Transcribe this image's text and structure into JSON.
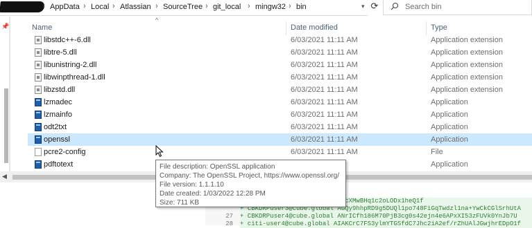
{
  "address_bar": {
    "path": [
      "AppData",
      "Local",
      "Atlassian",
      "SourceTree",
      "git_local",
      "mingw32",
      "bin"
    ],
    "separator": "›"
  },
  "search": {
    "placeholder": "Search bin"
  },
  "columns": {
    "name": "Name",
    "date": "Date modified",
    "type": "Type"
  },
  "files": [
    {
      "name": "libstdc++-6.dll",
      "date": "6/03/2021 11:11 AM",
      "type": "Application extension",
      "icon": "dll-file-icon"
    },
    {
      "name": "libtre-5.dll",
      "date": "6/03/2021 11:11 AM",
      "type": "Application extension",
      "icon": "dll-file-icon"
    },
    {
      "name": "libunistring-2.dll",
      "date": "6/03/2021 11:11 AM",
      "type": "Application extension",
      "icon": "dll-file-icon"
    },
    {
      "name": "libwinpthread-1.dll",
      "date": "6/03/2021 11:11 AM",
      "type": "Application extension",
      "icon": "dll-file-icon"
    },
    {
      "name": "libzstd.dll",
      "date": "6/03/2021 11:11 AM",
      "type": "Application extension",
      "icon": "dll-file-icon"
    },
    {
      "name": "lzmadec",
      "date": "6/03/2021 11:11 AM",
      "type": "Application",
      "icon": "application-icon"
    },
    {
      "name": "lzmainfo",
      "date": "6/03/2021 11:11 AM",
      "type": "Application",
      "icon": "application-icon"
    },
    {
      "name": "odt2txt",
      "date": "6/03/2021 11:11 AM",
      "type": "Application",
      "icon": "application-icon"
    },
    {
      "name": "openssl",
      "date": "6/03/2021 11:11 AM",
      "type": "Application",
      "icon": "application-icon",
      "selected": true
    },
    {
      "name": "pcre2-config",
      "date": "6/03/2021 11:11 AM",
      "type": "File",
      "icon": "generic-file-icon"
    },
    {
      "name": "pdftotext",
      "date": "",
      "type": "Application",
      "icon": "application-icon"
    }
  ],
  "tooltip": {
    "description": "File description: OpenSSL application",
    "company": "Company: The OpenSSL Project, https://www.openssl.org/",
    "version": "File version: 1.1.1.10",
    "created": "Date created: 1/03/2022 12:28 PM",
    "size": "Size: 711 KB"
  },
  "background_diff": {
    "lines": [
      {
        "num": "",
        "text": "AFgDnC5IBFhorgxy2JVMVPsrWaVVcXMwBHq1c2oLODx1heQ1f"
      },
      {
        "num": "",
        "text": "+ CBKDRPuser3@cube.global    AGQy9hhpRD9g5DUQl1po748FiGqTwdzl1na+YwCkCGlSrhUtA"
      },
      {
        "num": "27",
        "text": "+ CBKDRPuser4@cube.global    ANrICfh186M70PjB3cg0s42ejn4e6APxXI53zFUVk0YnJb7U"
      },
      {
        "num": "28",
        "text": "+ citi-user4@cube.global     AIAKCrC7FS3ylmYTGSfdC7Jhc2iA2ef/rZhUAlJGwjhrEDpO1f"
      }
    ]
  },
  "colors": {
    "selection": "#cce8ff",
    "header_text": "#4c607a",
    "diff_added": "#2e7d32"
  }
}
